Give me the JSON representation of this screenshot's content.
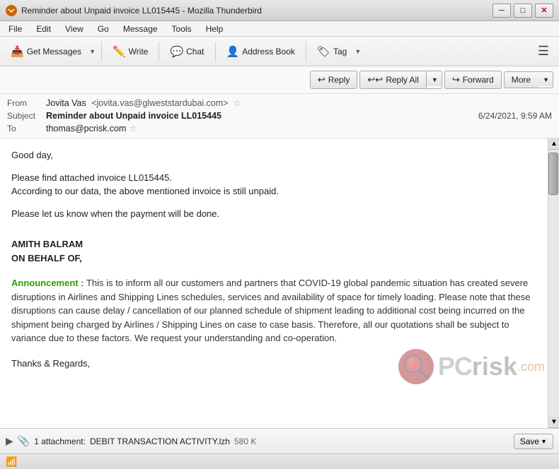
{
  "window": {
    "title": "Reminder about Unpaid invoice LL015445 - Mozilla Thunderbird",
    "icon": "🦅"
  },
  "titlebar": {
    "minimize": "─",
    "maximize": "□",
    "close": "✕"
  },
  "menubar": {
    "items": [
      "File",
      "Edit",
      "View",
      "Go",
      "Message",
      "Tools",
      "Help"
    ]
  },
  "toolbar": {
    "get_messages_label": "Get Messages",
    "write_label": "Write",
    "chat_label": "Chat",
    "address_book_label": "Address Book",
    "tag_label": "Tag"
  },
  "actions": {
    "reply_label": "Reply",
    "reply_all_label": "Reply All",
    "forward_label": "Forward",
    "more_label": "More"
  },
  "email": {
    "from_label": "From",
    "from_name": "Jovita Vas",
    "from_email": "<jovita.vas@glweststardubai.com>",
    "subject_label": "Subject",
    "subject": "Reminder about Unpaid invoice LL015445",
    "to_label": "To",
    "to": "thomas@pcrisk.com",
    "date": "6/24/2021, 9:59 AM"
  },
  "body": {
    "greeting": "Good day,",
    "para1": "Please find attached invoice LL015445.",
    "para2": "According to our data, the above mentioned invoice is still unpaid.",
    "para3": "Please let us know when the payment will be done.",
    "sig_name1": "AMITH BALRAM",
    "sig_name2": "ON BEHALF OF,",
    "announcement_label": "Announcement :",
    "announcement_text": " This is to inform all our customers and partners that COVID-19 global pandemic situation has created severe disruptions in Airlines and Shipping Lines schedules, services and availability of space for timely loading. Please note that these disruptions can cause delay / cancellation of our planned schedule of shipment leading to additional cost being incurred on the shipment being charged by Airlines / Shipping Lines on case to case basis. Therefore, all our quotations shall be subject to variance due to these factors. We request your understanding and co-operation.",
    "thanks": "Thanks & Regards,"
  },
  "attachment": {
    "filename": "DEBIT TRANSACTION ACTIVITY.lzh",
    "size": "580 K",
    "save_label": "Save"
  },
  "statusbar": {
    "wifi": "📶"
  }
}
